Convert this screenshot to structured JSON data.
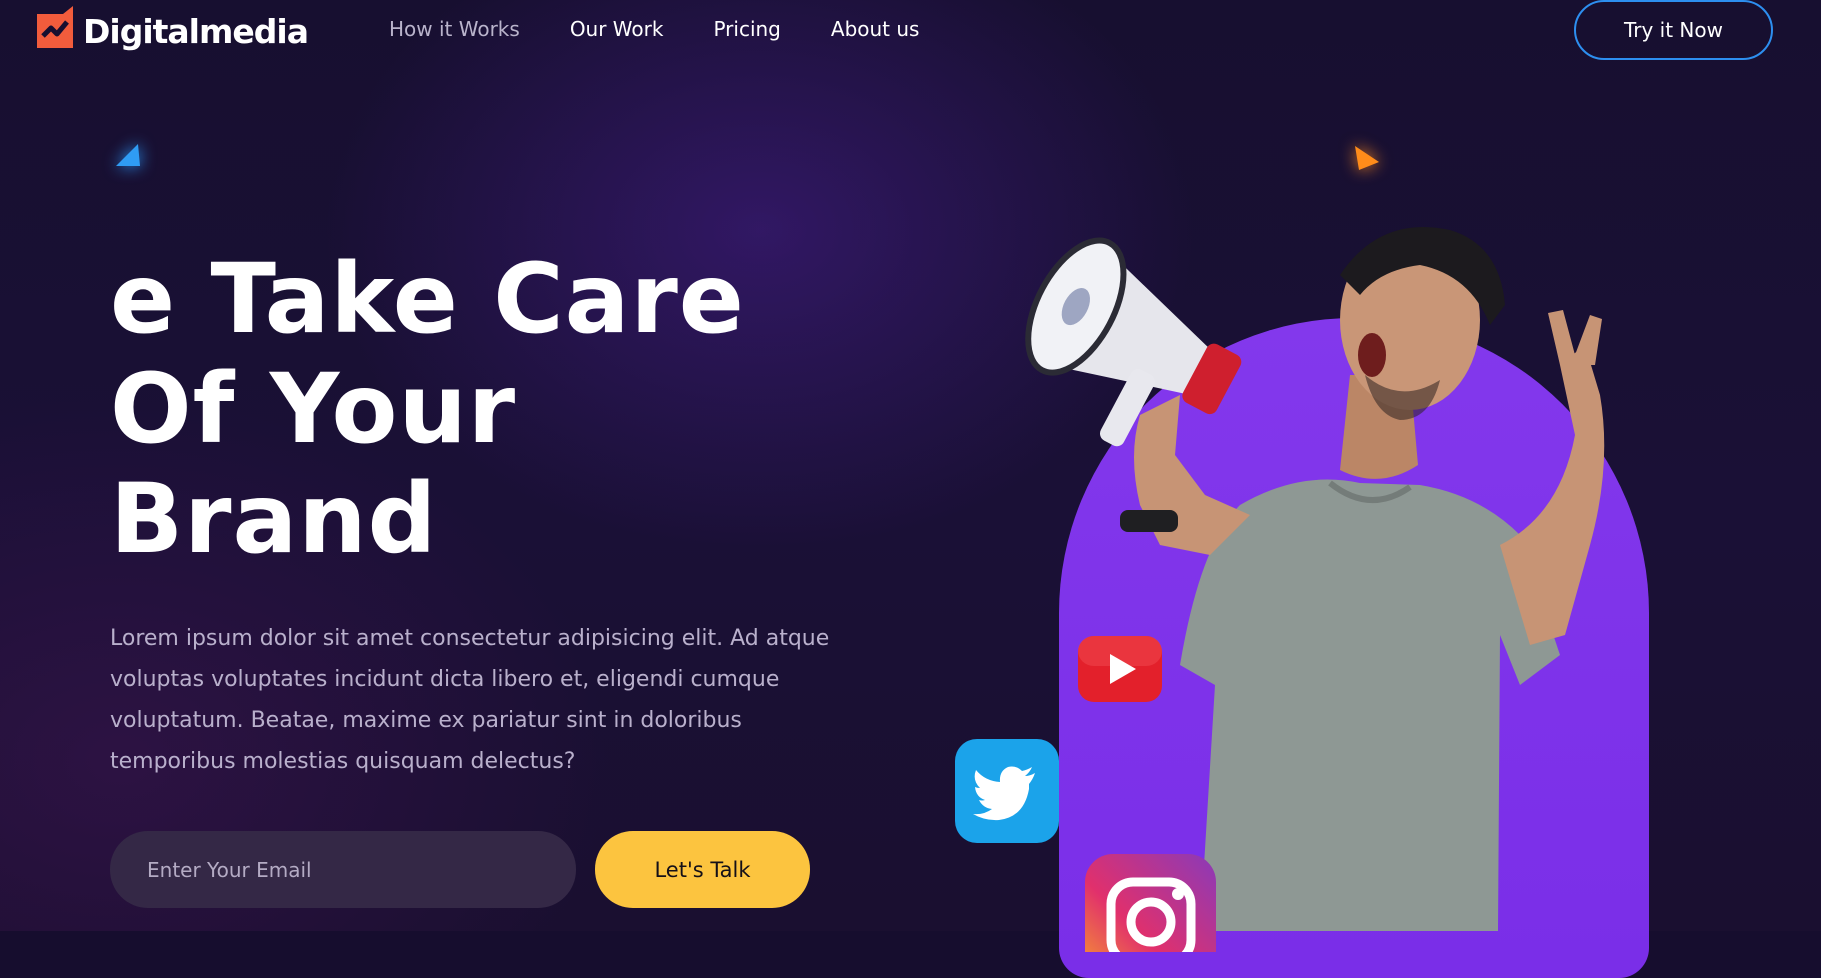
{
  "brand": {
    "name": "Digitalmedia"
  },
  "nav": {
    "items": [
      {
        "label": "How it Works"
      },
      {
        "label": "Our Work"
      },
      {
        "label": "Pricing"
      },
      {
        "label": "About us"
      }
    ],
    "cta_label": "Try it Now"
  },
  "hero": {
    "headline": [
      "e Take Care",
      "Of Your",
      "Brand"
    ],
    "description": "Lorem ipsum dolor sit amet consectetur adipisicing elit. Ad atque voluptas voluptates incidunt dicta libero et, eligendi cumque voluptatum. Beatae, maxime ex pariatur sint in doloribus temporibus molestias quisquam delectus?",
    "email_placeholder": "Enter Your Email",
    "email_value": "",
    "submit_label": "Let's Talk"
  },
  "icons": [
    "logo-mark-icon",
    "youtube-icon",
    "twitter-icon",
    "instagram-icon"
  ],
  "colors": {
    "background": "#160d2e",
    "accent_yellow": "#fcc43f",
    "accent_purple": "#8338ec",
    "cta_border": "#2d8ff0",
    "logo_orange": "#f25c3c"
  }
}
